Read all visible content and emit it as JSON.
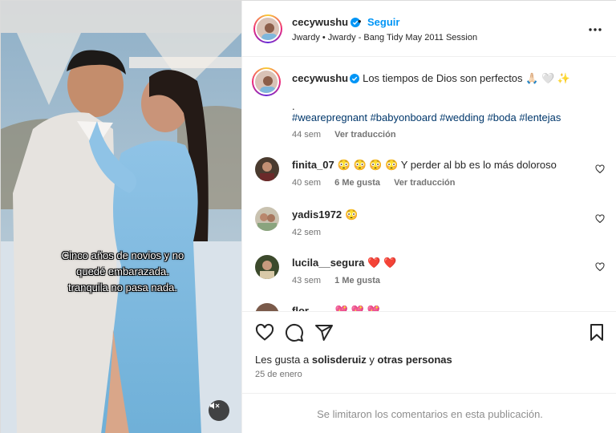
{
  "media": {
    "overlay_lines": [
      "Cinco años de novios y no",
      "quedé embarazada.",
      "tranquila no pasa nada."
    ],
    "mute_icon": "speaker-muted-icon"
  },
  "header": {
    "username": "cecywushu",
    "dot": "•",
    "follow_label": "Seguir",
    "subtitle": "Jwardy • Jwardy - Bang Tidy May 2011 Session",
    "more_icon": "more-options-icon"
  },
  "caption": {
    "username": "cecywushu",
    "text": "Los tiempos de Dios son perfectos 🙏🏻 🤍 ✨",
    "dot_line": ".",
    "hashtags": "#wearepregnant #babyonboard #wedding #boda #lentejas",
    "time": "44 sem",
    "translate": "Ver traducción"
  },
  "comments": [
    {
      "username": "finita_07",
      "text": "😳 😳 😳 😳 Y perder al bb es lo más doloroso",
      "time": "40 sem",
      "likes": "6 Me gusta",
      "translate": "Ver traducción"
    },
    {
      "username": "yadis1972",
      "text": "😳",
      "time": "42 sem"
    },
    {
      "username": "lucila__segura",
      "text": "❤️ ❤️",
      "time": "43 sem",
      "likes": "1 Me gusta"
    },
    {
      "username": "flor____",
      "text": "💖 💖 💖"
    }
  ],
  "actions": {
    "likes_prefix": "Les gusta a",
    "likes_user": "solisderuiz",
    "likes_mid": "y",
    "likes_others": "otras personas",
    "date": "25 de enero"
  },
  "footer": {
    "limited_text": "Se limitaron los comentarios en esta publicación."
  },
  "colors": {
    "accent": "#0095f6",
    "text": "#262626",
    "secondary": "#737373",
    "heart": "#ed4956"
  }
}
